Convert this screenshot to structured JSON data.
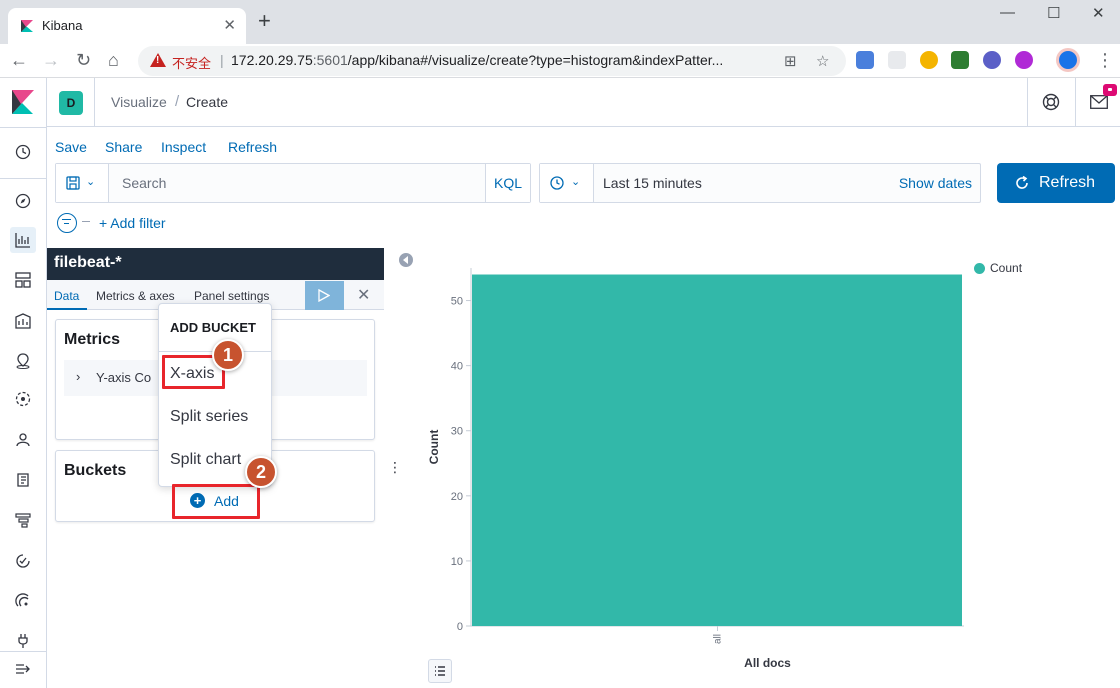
{
  "browser": {
    "tab_title": "Kibana",
    "insecure_label": "不安全",
    "url_host": "172.20.29.75",
    "url_port": ":5601",
    "url_path": "/app/kibana#/visualize/create?type=histogram&indexPatter..."
  },
  "header": {
    "space_initial": "D",
    "breadcrumb_root": "Visualize",
    "breadcrumb_current": "Create"
  },
  "top_menu": {
    "save": "Save",
    "share": "Share",
    "inspect": "Inspect",
    "refresh": "Refresh"
  },
  "query_bar": {
    "search_placeholder": "Search",
    "language": "KQL",
    "time_range": "Last 15 minutes",
    "show_dates": "Show dates",
    "refresh_button": "Refresh"
  },
  "filters": {
    "add_filter": "+ Add filter"
  },
  "editor": {
    "index_pattern": "filebeat-*",
    "tabs": [
      "Data",
      "Metrics & axes",
      "Panel settings"
    ],
    "metrics_title": "Metrics",
    "metric_item": "Y-axis Co",
    "buckets_title": "Buckets",
    "add_button": "Add"
  },
  "add_bucket_popover": {
    "title": "ADD BUCKET",
    "items": [
      "X-axis",
      "Split series",
      "Split chart"
    ]
  },
  "annotations": {
    "step1": "1",
    "step2": "2",
    "highlight_color": "#e8252b",
    "badge_color": "#c7532f"
  },
  "colors": {
    "accent": "#006bb4",
    "series": "#32b8a9",
    "dark_bar": "#1f2d3d"
  },
  "chart_data": {
    "type": "bar",
    "categories": [
      "all"
    ],
    "series": [
      {
        "name": "Count",
        "values": [
          54
        ]
      }
    ],
    "xlabel": "All docs",
    "ylabel": "Count",
    "ylim": [
      0,
      55
    ],
    "yticks": [
      0,
      10,
      20,
      30,
      40,
      50
    ],
    "legend": "top-right",
    "grid": false
  }
}
